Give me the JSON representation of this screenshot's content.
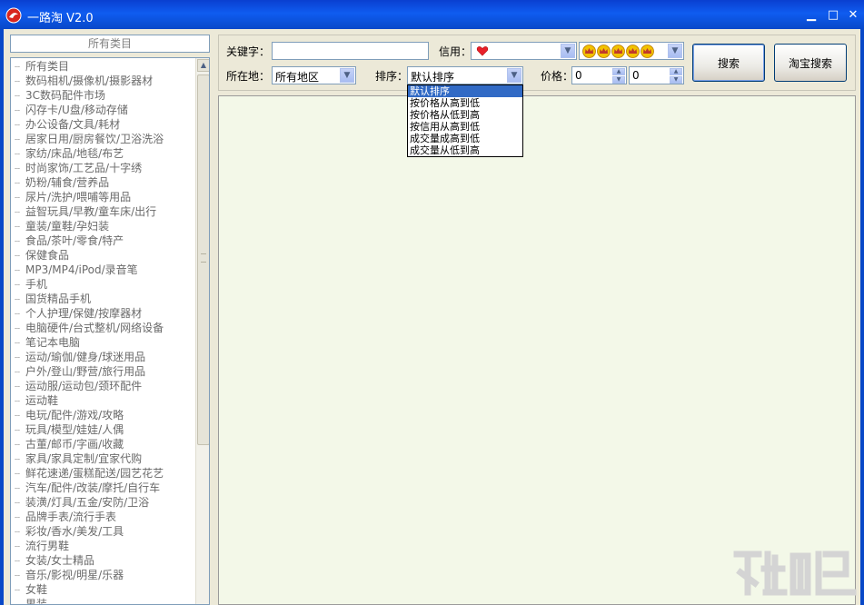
{
  "window": {
    "title": "一路淘 V2.0",
    "controls": {
      "minimize": "▁",
      "maximize": "□",
      "close": "✕"
    }
  },
  "sidebar": {
    "header": "所有类目",
    "categories": [
      "所有类目",
      "数码相机/摄像机/摄影器材",
      "3C数码配件市场",
      "闪存卡/U盘/移动存储",
      "办公设备/文具/耗材",
      "居家日用/厨房餐饮/卫浴洗浴",
      "家纺/床品/地毯/布艺",
      "时尚家饰/工艺品/十字绣",
      "奶粉/辅食/营养品",
      "尿片/洗护/喂哺等用品",
      "益智玩具/早教/童车床/出行",
      "童装/童鞋/孕妇装",
      "食品/茶叶/零食/特产",
      "保健食品",
      "MP3/MP4/iPod/录音笔",
      "手机",
      "国货精品手机",
      "个人护理/保健/按摩器材",
      "电脑硬件/台式整机/网络设备",
      "笔记本电脑",
      "运动/瑜伽/健身/球迷用品",
      "户外/登山/野营/旅行用品",
      "运动服/运动包/颈环配件",
      "运动鞋",
      "电玩/配件/游戏/攻略",
      "玩具/模型/娃娃/人偶",
      "古董/邮币/字画/收藏",
      "家具/家具定制/宜家代购",
      "鲜花速递/蛋糕配送/园艺花艺",
      "汽车/配件/改装/摩托/自行车",
      "装潢/灯具/五金/安防/卫浴",
      "品牌手表/流行手表",
      "彩妆/香水/美发/工具",
      "流行男鞋",
      "女装/女士精品",
      "音乐/影视/明星/乐器",
      "女鞋",
      "男装"
    ]
  },
  "search": {
    "keyword_label": "关键字：",
    "keyword_value": "",
    "credit_label": "信用：",
    "location_label": "所在地：",
    "location_value": "所有地区",
    "sort_label": "排序：",
    "sort_value": "默认排序",
    "sort_options": [
      "默认排序",
      "按价格从高到低",
      "按价格从低到高",
      "按信用从高到低",
      "成交量成高到低",
      "成交量从低到高"
    ],
    "price_label": "价格：",
    "price_min": "0",
    "price_max": "0",
    "search_button": "搜索",
    "taobao_button": "淘宝搜索"
  },
  "colors": {
    "titlebar": "#0f5cf0",
    "results_bg": "#f3f8e8",
    "selected": "#316ac5",
    "heart": "#e8202a",
    "crown": "#e0a000"
  },
  "icons": {
    "app": "app-logo-icon",
    "credit_low": "heart-icon",
    "credit_high": "crown-icon"
  }
}
